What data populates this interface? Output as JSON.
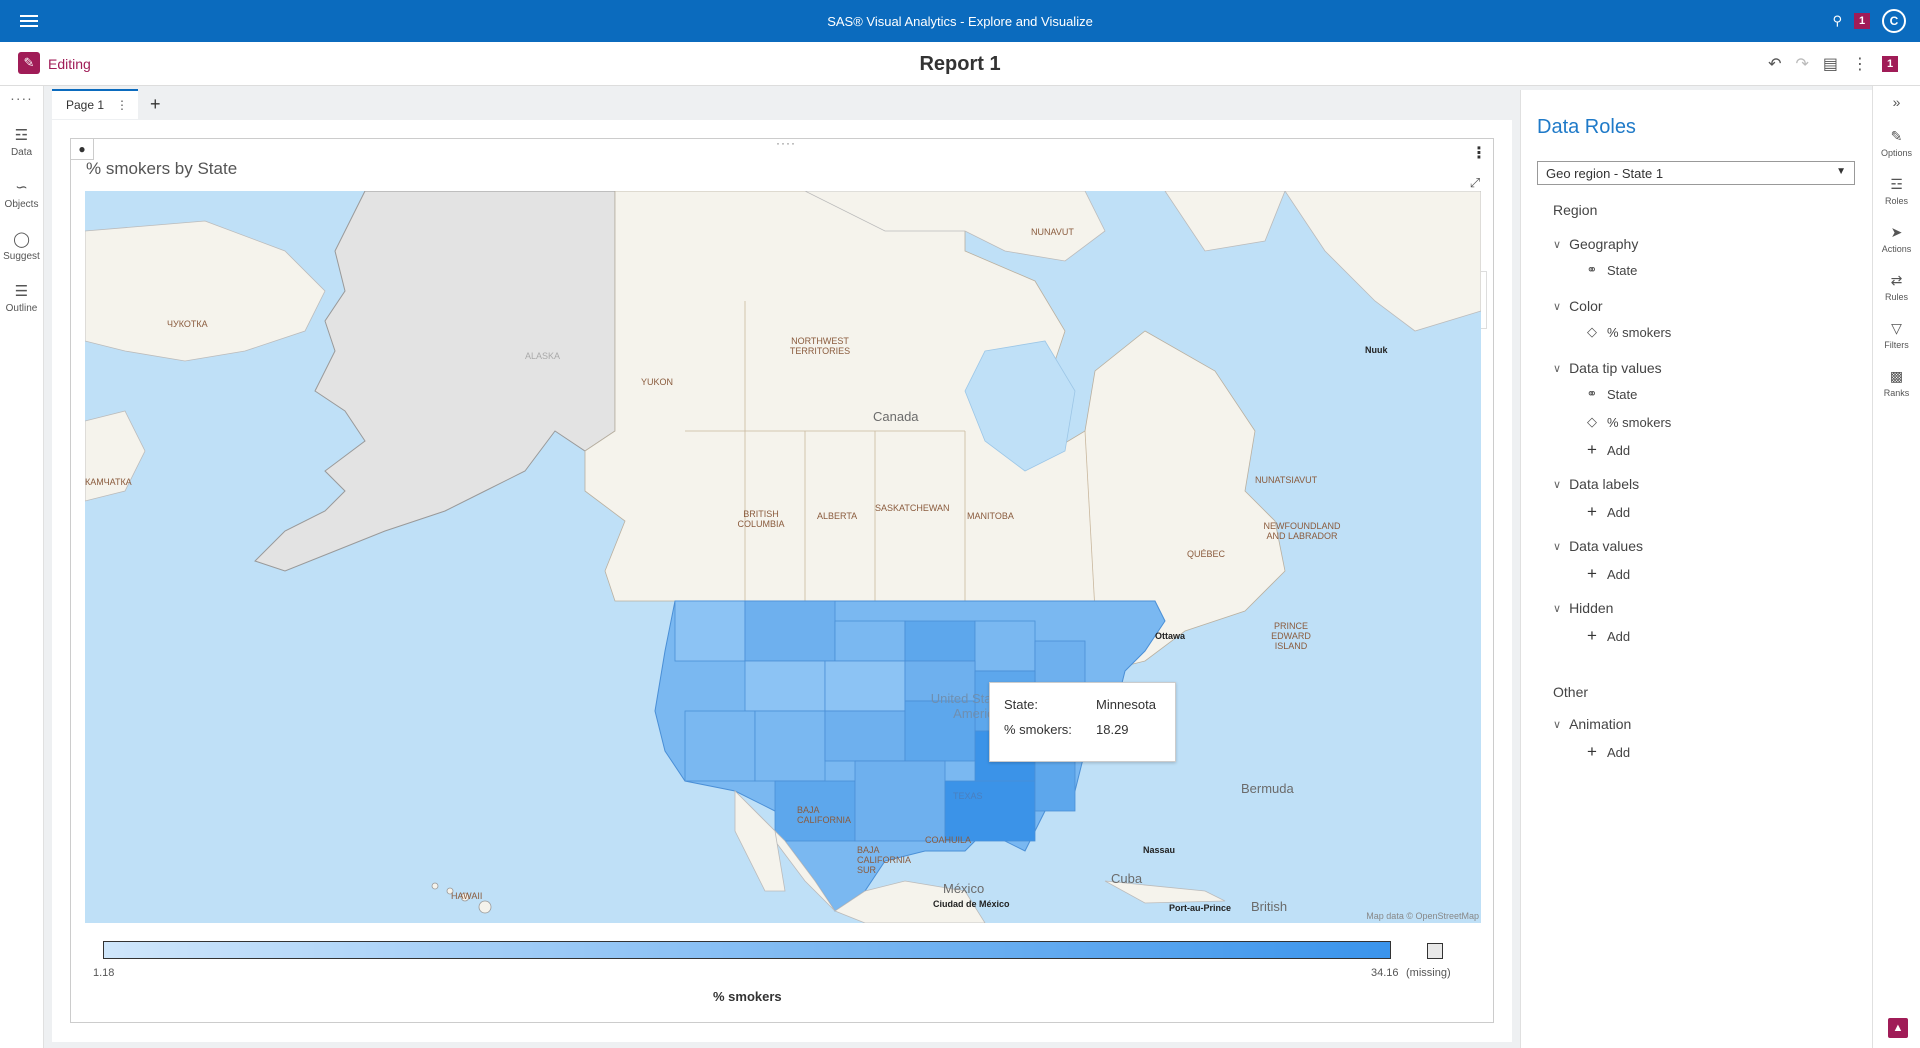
{
  "app": {
    "title": "SAS® Visual Analytics - Explore and Visualize",
    "notification_count": "1",
    "user_initial": "C"
  },
  "report": {
    "mode_label": "Editing",
    "title": "Report 1",
    "badge_count": "1"
  },
  "left_rail": {
    "items": [
      {
        "label": "Data",
        "icon": "database-icon"
      },
      {
        "label": "Objects",
        "icon": "chart-icon"
      },
      {
        "label": "Suggest",
        "icon": "lightbulb-icon"
      },
      {
        "label": "Outline",
        "icon": "list-icon"
      }
    ]
  },
  "tabs": [
    {
      "label": "Page 1"
    }
  ],
  "map_object": {
    "title": "% smokers by State",
    "map_labels": {
      "nunavut": "NUNAVUT",
      "chukotka": "ЧУКОТКА",
      "kamchatka": "КАМЧАТКА",
      "alaska": "ALASKA",
      "yukon": "YUKON",
      "nwt": "NORTHWEST TERRITORIES",
      "canada": "Canada",
      "bc": "BRITISH COLUMBIA",
      "alberta": "ALBERTA",
      "sask": "SASKATCHEWAN",
      "manitoba": "MANITOBA",
      "quebec": "QUÉBEC",
      "nunatsiavut": "NUNATSIAVUT",
      "nfld": "NEWFOUNDLAND AND LABRADOR",
      "pei": "PRINCE EDWARD ISLAND",
      "ottawa": "Ottawa",
      "nuuk": "Nuuk",
      "usa": "United States of America",
      "bermuda": "Bermuda",
      "nassau": "Nassau",
      "hawaii": "HAWAII",
      "bajac": "BAJA CALIFORNIA",
      "bajas": "BAJA CALIFORNIA SUR",
      "coahuila": "COAHUILA",
      "texas": "TEXAS",
      "mexico": "México",
      "cdmx": "Ciudad de México",
      "cuba": "Cuba",
      "portauprince": "Port-au-Prince",
      "british": "British",
      "attribution": "Map data © OpenStreetMap"
    },
    "tooltip": {
      "state_key": "State:",
      "state_value": "Minnesota",
      "value_key": "% smokers:",
      "value_value": "18.29"
    },
    "legend": {
      "min": "1.18",
      "max": "34.16",
      "missing": "(missing)",
      "title": "% smokers",
      "color_low": "#cfe6fb",
      "color_high": "#3a94ec"
    }
  },
  "data_roles": {
    "title": "Data Roles",
    "selected_object": "Geo region - State 1",
    "region_label": "Region",
    "groups": {
      "geography": {
        "label": "Geography",
        "items": [
          "State"
        ]
      },
      "color": {
        "label": "Color",
        "items": [
          "% smokers"
        ]
      },
      "data_tip": {
        "label": "Data tip values",
        "items": [
          "State",
          "% smokers"
        ],
        "add": "Add"
      },
      "data_labels": {
        "label": "Data labels",
        "add": "Add"
      },
      "data_values": {
        "label": "Data values",
        "add": "Add"
      },
      "hidden": {
        "label": "Hidden",
        "add": "Add"
      }
    },
    "other_label": "Other",
    "animation": {
      "label": "Animation",
      "add": "Add"
    }
  },
  "right_rail": {
    "items": [
      {
        "label": "Options"
      },
      {
        "label": "Roles"
      },
      {
        "label": "Actions"
      },
      {
        "label": "Rules"
      },
      {
        "label": "Filters"
      },
      {
        "label": "Ranks"
      }
    ]
  },
  "colors": {
    "brand_blue": "#0b6bbe",
    "accent_magenta": "#a01c57"
  }
}
